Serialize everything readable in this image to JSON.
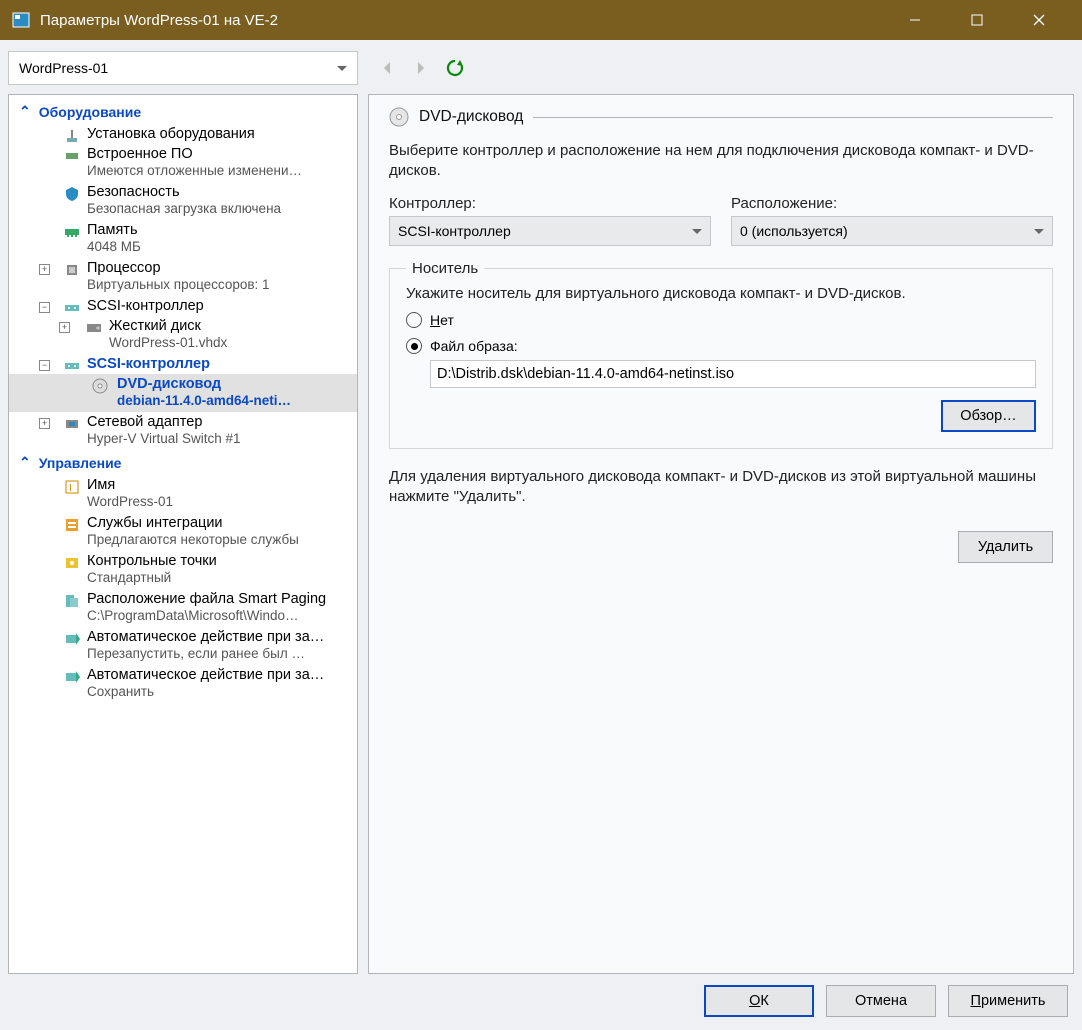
{
  "window": {
    "title": "Параметры WordPress-01 на VE-2"
  },
  "vm_dropdown": "WordPress-01",
  "tree": {
    "section_hw": "Оборудование",
    "add_hw": "Установка оборудования",
    "firmware": {
      "label": "Встроенное ПО",
      "sub": "Имеются отложенные изменени…"
    },
    "security": {
      "label": "Безопасность",
      "sub": "Безопасная загрузка включена"
    },
    "memory": {
      "label": "Память",
      "sub": "4048 МБ"
    },
    "cpu": {
      "label": "Процессор",
      "sub": "Виртуальных процессоров: 1"
    },
    "scsi1": {
      "label": "SCSI-контроллер"
    },
    "hdd": {
      "label": "Жесткий диск",
      "sub": "WordPress-01.vhdx"
    },
    "scsi2": {
      "label": "SCSI-контроллер"
    },
    "dvd": {
      "label": "DVD-дисковод",
      "sub": "debian-11.4.0-amd64-neti…"
    },
    "nic": {
      "label": "Сетевой адаптер",
      "sub": "Hyper-V Virtual Switch #1"
    },
    "section_mgmt": "Управление",
    "name": {
      "label": "Имя",
      "sub": "WordPress-01"
    },
    "integration": {
      "label": "Службы интеграции",
      "sub": "Предлагаются некоторые службы"
    },
    "checkpoints": {
      "label": "Контрольные точки",
      "sub": "Стандартный"
    },
    "paging": {
      "label": "Расположение файла Smart Paging",
      "sub": "C:\\ProgramData\\Microsoft\\Windo…"
    },
    "autostart": {
      "label": "Автоматическое действие при за…",
      "sub": "Перезапустить, если ранее был …"
    },
    "autostop": {
      "label": "Автоматическое действие при за…",
      "sub": "Сохранить"
    }
  },
  "panel": {
    "title": "DVD-дисковод",
    "desc": "Выберите контроллер и расположение на нем для подключения дисковода компакт- и DVD-дисков.",
    "ctrl_label": "Контроллер:",
    "ctrl_value": "SCSI-контроллер",
    "loc_label": "Расположение:",
    "loc_value": "0 (используется)",
    "media_legend": "Носитель",
    "media_desc": "Укажите носитель для виртуального дисковода компакт- и DVD-дисков.",
    "radio_none_prefix": "Н",
    "radio_none_rest": "ет",
    "radio_image": "Файл образа:",
    "image_path": "D:\\Distrib.dsk\\debian-11.4.0-amd64-netinst.iso",
    "browse": "Обзор…",
    "delete_desc": "Для удаления виртуального дисковода компакт- и DVD-дисков из этой виртуальной машины нажмите \"Удалить\".",
    "delete_btn": "Удалить"
  },
  "buttons": {
    "ok_prefix": "О",
    "ok_rest": "К",
    "cancel": "Отмена",
    "apply_prefix": "П",
    "apply_rest": "рименить"
  }
}
